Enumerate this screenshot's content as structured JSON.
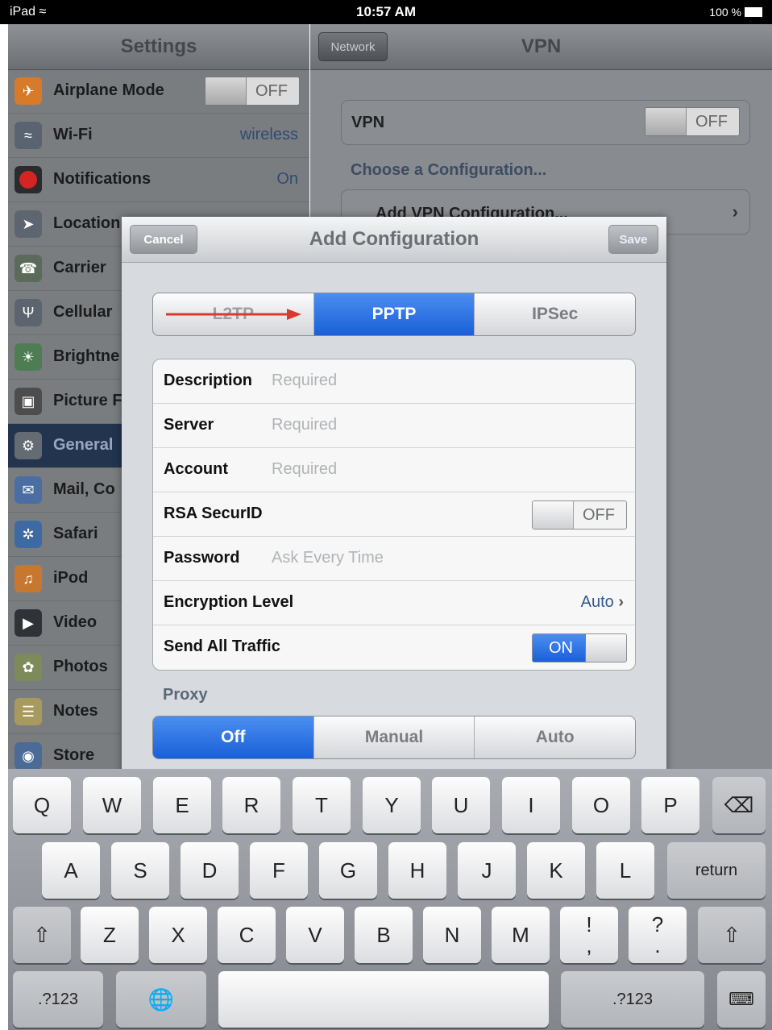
{
  "status_bar": {
    "device": "iPad",
    "time": "10:57 AM",
    "battery": "100 %"
  },
  "settings": {
    "title": "Settings",
    "items": [
      {
        "label": "Airplane Mode",
        "toggle": "OFF",
        "icon": "airplane-icon"
      },
      {
        "label": "Wi-Fi",
        "value": "wireless",
        "icon": "wifi-icon"
      },
      {
        "label": "Notifications",
        "value": "On",
        "icon": "notifications-icon"
      },
      {
        "label": "Location",
        "value": "",
        "icon": "location-icon"
      },
      {
        "label": "Carrier",
        "value": "",
        "icon": "phone-icon"
      },
      {
        "label": "Cellular",
        "value": "",
        "icon": "cellular-icon"
      },
      {
        "label": "Brightne",
        "value": "",
        "icon": "brightness-icon"
      },
      {
        "label": "Picture F",
        "value": "",
        "icon": "picture-frame-icon"
      },
      {
        "label": "General",
        "value": "",
        "icon": "gear-icon"
      },
      {
        "label": "Mail, Co",
        "value": "",
        "icon": "mail-icon"
      },
      {
        "label": "Safari",
        "value": "",
        "icon": "compass-icon"
      },
      {
        "label": "iPod",
        "value": "",
        "icon": "ipod-icon"
      },
      {
        "label": "Video",
        "value": "",
        "icon": "video-icon"
      },
      {
        "label": "Photos",
        "value": "",
        "icon": "photos-icon"
      },
      {
        "label": "Notes",
        "value": "",
        "icon": "notes-icon"
      },
      {
        "label": "Store",
        "value": "",
        "icon": "store-icon"
      }
    ]
  },
  "vpn_pane": {
    "back_label": "Network",
    "title": "VPN",
    "vpn_label": "VPN",
    "vpn_toggle": "OFF",
    "choose_label": "Choose a Configuration...",
    "add_label": "Add VPN Configuration..."
  },
  "modal": {
    "title": "Add Configuration",
    "cancel_label": "Cancel",
    "save_label": "Save",
    "protocol_tabs": [
      "L2TP",
      "PPTP",
      "IPSec"
    ],
    "selected_protocol": "PPTP",
    "fields": {
      "description": {
        "label": "Description",
        "placeholder": "Required"
      },
      "server": {
        "label": "Server",
        "placeholder": "Required"
      },
      "account": {
        "label": "Account",
        "placeholder": "Required"
      },
      "rsa": {
        "label": "RSA SecurID",
        "toggle": "OFF"
      },
      "password": {
        "label": "Password",
        "placeholder": "Ask Every Time"
      },
      "encryption": {
        "label": "Encryption Level",
        "value": "Auto"
      },
      "send_all": {
        "label": "Send All Traffic",
        "toggle": "ON"
      }
    },
    "proxy_label": "Proxy",
    "proxy_tabs": [
      "Off",
      "Manual",
      "Auto"
    ],
    "selected_proxy": "Off"
  },
  "keyboard": {
    "row1": [
      "Q",
      "W",
      "E",
      "R",
      "T",
      "Y",
      "U",
      "I",
      "O",
      "P"
    ],
    "row2": [
      "A",
      "S",
      "D",
      "F",
      "G",
      "H",
      "J",
      "K",
      "L"
    ],
    "row3": [
      "Z",
      "X",
      "C",
      "V",
      "B",
      "N",
      "M"
    ],
    "return_label": "return",
    "num_label": ".?123",
    "punct1": {
      "top": "!",
      "bottom": ","
    },
    "punct2": {
      "top": "?",
      "bottom": "."
    }
  }
}
